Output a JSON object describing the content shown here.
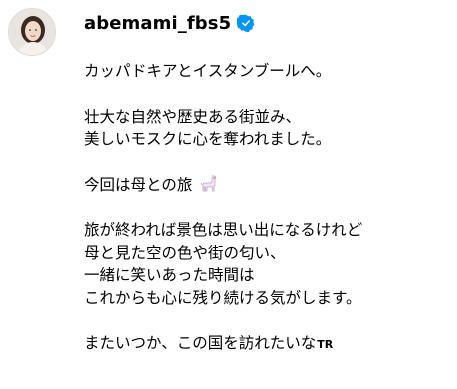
{
  "post": {
    "username": "abemami_fbs5",
    "verified_icon": "verified-badge-icon",
    "avatar_icon": "profile-photo",
    "caption": {
      "line1": "カッパドキアとイスタンブールへ。",
      "line2": "壮大な自然や歴史ある街並み、",
      "line3": "美しいモスクに心を奪われました。",
      "line4": "今回は母との旅",
      "line4_emoji": "llama-emoji",
      "line5": "旅が終われば景色は思い出になるけれど",
      "line6": "母と見た空の色や街の匂い、",
      "line7": "一緒に笑いあった時間は",
      "line8": "これからも心に残り続ける気がします。",
      "line9": "またいつか、この国を訪れたいな",
      "translate_label": "TR"
    },
    "colors": {
      "verified": "#0095f6",
      "text": "#000000",
      "background": "#ffffff"
    }
  }
}
